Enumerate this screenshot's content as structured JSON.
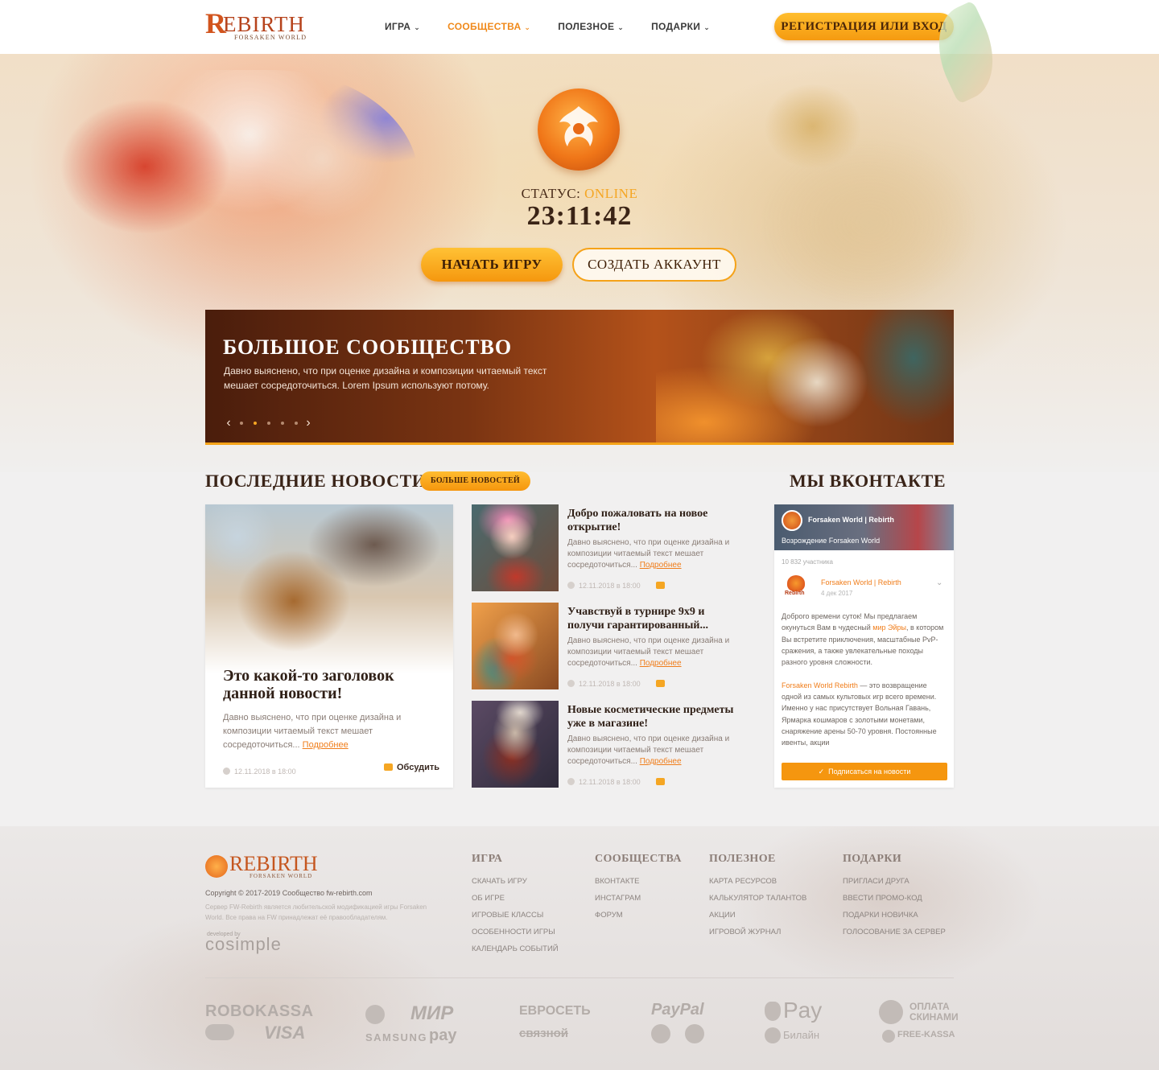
{
  "header": {
    "logo": {
      "initial": "R",
      "word": "EBIRTH",
      "subtitle": "FORSAKEN WORLD"
    },
    "nav": [
      {
        "label": "ИГРА",
        "active": false
      },
      {
        "label": "СООБЩЕСТВА",
        "active": true
      },
      {
        "label": "ПОЛЕЗНОЕ",
        "active": false
      },
      {
        "label": "ПОДАРКИ",
        "active": false
      }
    ],
    "register_button": "РЕГИСТРАЦИЯ ИЛИ ВХОД"
  },
  "hero": {
    "status_label": "СТАТУС:",
    "status_value": "ONLINE",
    "server_time": "23:11:42",
    "play_button": "НАЧАТЬ ИГРУ",
    "create_button": "СОЗДАТЬ АККАУНТ"
  },
  "slider": {
    "title": "БОЛЬШОЕ СООБЩЕСТВО",
    "text": "Давно выяснено, что при оценке дизайна и композиции читаемый текст мешает сосредоточиться. Lorem Ipsum используют потому.",
    "slide_count": 5,
    "active_slide": 2
  },
  "news": {
    "title": "ПОСЛЕДНИЕ НОВОСТИ",
    "more_button": "БОЛЬШЕ НОВОСТЕЙ",
    "featured": {
      "title": "Это какой-то заголовок данной новости!",
      "text": "Давно выяснено, что при оценке дизайна и композиции читаемый текст мешает сосредоточиться...",
      "more_link": "Подробнее",
      "date": "12.11.2018 в 18:00",
      "discuss": "Обсудить"
    },
    "items": [
      {
        "title": "Добро пожаловать на новое открытие!",
        "text": "Давно выяснено, что при оценке дизайна и композиции читаемый текст мешает сосредоточиться...",
        "more_link": "Подробнее",
        "date": "12.11.2018 в 18:00"
      },
      {
        "title": "Учавствуй в турнире 9х9 и получи гарантированный...",
        "text": "Давно выяснено, что при оценке дизайна и композиции читаемый текст мешает сосредоточиться...",
        "more_link": "Подробнее",
        "date": "12.11.2018 в 18:00"
      },
      {
        "title": "Новые косметические предметы уже в магазине!",
        "text": "Давно выяснено, что при оценке дизайна и композиции читаемый текст мешает сосредоточиться...",
        "more_link": "Подробнее",
        "date": "12.11.2018 в 18:00"
      }
    ]
  },
  "vk": {
    "title": "МЫ ВКОНТАКТЕ",
    "group_name": "Forsaken World | Rebirth",
    "group_status": "Возрождение Forsaken World",
    "members": "10 832 участника",
    "post_author": "Forsaken World | Rebirth",
    "post_date": "4 дек 2017",
    "avatar_label": "Rebirth",
    "post_p1_before": "Доброго времени суток! Мы предлагаем окунуться Вам в чудесный ",
    "post_p1_link": "мир Эйры",
    "post_p1_after": ", в котором Вы встретите приключения, масштабные PvP-сражения, а также увлекательные походы разного уровня сложности.",
    "post_p2_link": "Forsaken World Rebirth",
    "post_p2_after": " — это возвращение одной из самых культовых игр всего времени. Именно у нас присутствует Вольная Гавань, Ярмарка кошмаров с золотыми монетами, снаряжение арены 50-70 уровня. Постоянные ивенты, акции",
    "subscribe_button": "Подписаться на новости"
  },
  "footer": {
    "logo_word": "REBIRTH",
    "logo_sub": "FORSAKEN WORLD",
    "copyright": "Copyright © 2017-2019 Сообщество fw-rebirth.com",
    "disclaimer": "Сервер FW-Rebirth является любительской модификацией игры Forsaken World. Все права на FW принадлежат её правообладателям.",
    "developed_by": "developed by",
    "developer": "cosimple",
    "columns": [
      {
        "title": "ИГРА",
        "links": [
          "СКАЧАТЬ ИГРУ",
          "ОБ ИГРЕ",
          "ИГРОВЫЕ КЛАССЫ",
          "ОСОБЕННОСТИ ИГРЫ",
          "КАЛЕНДАРЬ СОБЫТИЙ"
        ]
      },
      {
        "title": "СООБЩЕСТВА",
        "links": [
          "ВКОНТАКТЕ",
          "ИНСТАГРАМ",
          "ФОРУМ"
        ]
      },
      {
        "title": "ПОЛЕЗНОЕ",
        "links": [
          "КАРТА РЕСУРСОВ",
          "КАЛЬКУЛЯТОР ТАЛАНТОВ",
          "АКЦИИ",
          "ИГРОВОЙ ЖУРНАЛ"
        ]
      },
      {
        "title": "ПОДАРКИ",
        "links": [
          "ПРИГЛАСИ ДРУГА",
          "ВВЕСТИ ПРОМО-КОД",
          "ПОДАРКИ НОВИЧКА",
          "ГОЛОСОВАНИЕ ЗА СЕРВЕР"
        ]
      }
    ],
    "payments": {
      "robokassa": "ROBOKASSA",
      "visa": "VISA",
      "mir": "МИР",
      "samsung": "SAMSUNG",
      "pay": "pay",
      "euroset": "ЕВРОСЕТЬ",
      "svyaznoy": "связной",
      "paypal": "PayPal",
      "apple_pay": "Pay",
      "beeline": "Билайн",
      "skins_1": "ОПЛАТА",
      "skins_2": "СКИНАМИ",
      "freekassa": "FREE-KASSA"
    }
  }
}
